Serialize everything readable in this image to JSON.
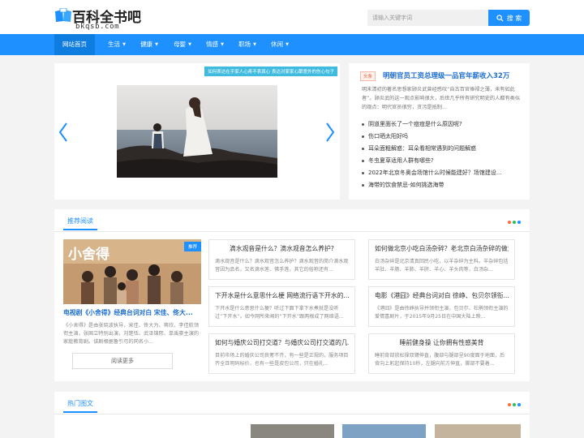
{
  "header": {
    "logo_text": "百科全书吧",
    "logo_domain": "bkqsb.com",
    "search_placeholder": "请输入关键字词",
    "search_button": "搜 索"
  },
  "nav": [
    {
      "label": "网站首页",
      "active": true,
      "caret": false
    },
    {
      "label": "生活",
      "active": false,
      "caret": true
    },
    {
      "label": "健康",
      "active": false,
      "caret": true
    },
    {
      "label": "母婴",
      "active": false,
      "caret": true
    },
    {
      "label": "情感",
      "active": false,
      "caret": true
    },
    {
      "label": "职场",
      "active": false,
      "caret": true
    },
    {
      "label": "休闲",
      "active": false,
      "caret": true
    }
  ],
  "slider": {
    "caption": "如何表达在乎家人心疼不表真心 表达对家家心跟意外的伤心句子"
  },
  "news": {
    "tag": "头条",
    "headline": "明朝官员工资总理级一品官年薪收入32万",
    "summary": "明末清初的著名思想家顾炎武曾经感叹“自古百官俸禄之薄，未有如此者”。顾炎武的这一观点影响很大，后世几乎所有研究明史的人都有类似的观点：明代官员很穷，贪污是抵制...",
    "items": [
      "阴道里面长了一个痘痘是什么原因呢?",
      "伤口晒太阳好吗",
      "耳朵面粗解惑：耳朵看相常遇到的问题解惑",
      "冬虫夏草适用人群有哪些?",
      "2022年北京冬奥会场馆什么时候能建好？场馆建设...",
      "海带的饮食禁忌-如何挑选海带"
    ]
  },
  "recommend": {
    "section_title": "推荐阅读",
    "feature": {
      "badge": "推荐",
      "image_text": "小舍得",
      "title": "电视剧《小舍得》经典台词对白 宋佳、佟大...",
      "desc": "《小舍得》是由张晓波执导，宋佳、佟大为、蒋欣、李佳航领衔主演，张国立特别出演，刘楚恬、武泽锦熙、单禹豪主演的家庭教育剧。该剧根据鲁引弓的同名小...",
      "read_more": "阅读更多"
    },
    "cards": [
      {
        "title": "滴水观音是什么？滴水观音怎么养护?",
        "desc": "滴水观音是什么？滴水观音怎么养护？滴水观音的简介滴水观音因为品名，又名滴水莲、佛手莲，其它的俗称还有..."
      },
      {
        "title": "如何做北京小吃白汤杂碎？老北京白汤杂碎的做法",
        "desc": "白汤杂碎是北京清真回民小吃，以羊杂碎为主料。羊杂碎包括羊肚、羊肠、羊肺、羊肝、羊心、羊头肉等，白汤杂..."
      },
      {
        "title": "下开水是什么意思什么梗 网络流行语下开水的...",
        "desc": "下开水是什么意思什么梗？听过下面下拿下水煮就是没听过“下开水”。如今网所来闻的“下开水”跟两根成了网络语..."
      },
      {
        "title": "电影《港囧》经典台词对白 徐峥、包贝尔领衔...",
        "desc": "《港囧》是由徐峥执导并领衔主演，包贝尔、杜鹃领衔主演的爱情喜剧片，于2015年9月25日在中国大陆上映..."
      },
      {
        "title": "如何与婚庆公司打交道？与婚庆公司打交道的几...",
        "desc": "目前市场上的婚庆公司良莠不齐，有一些是正规的，服务项目齐全且明码标价，也有一些是皮包公司，只在婚礼..."
      },
      {
        "title": "睡前健身操 让你拥有性感美背",
        "desc": "睡前背部放松操双臂伸直，腹部与腿部呈90度面于地面，后背向上躬起保持10秒，左腿向前方伸直，脚部不要着..."
      }
    ]
  },
  "hot": {
    "section_title": "热门图文"
  },
  "colors": {
    "accent": "#1e90ff",
    "dot1": "#ff6b3d",
    "dot2": "#2bbf5a",
    "dot3": "#1e90ff"
  }
}
